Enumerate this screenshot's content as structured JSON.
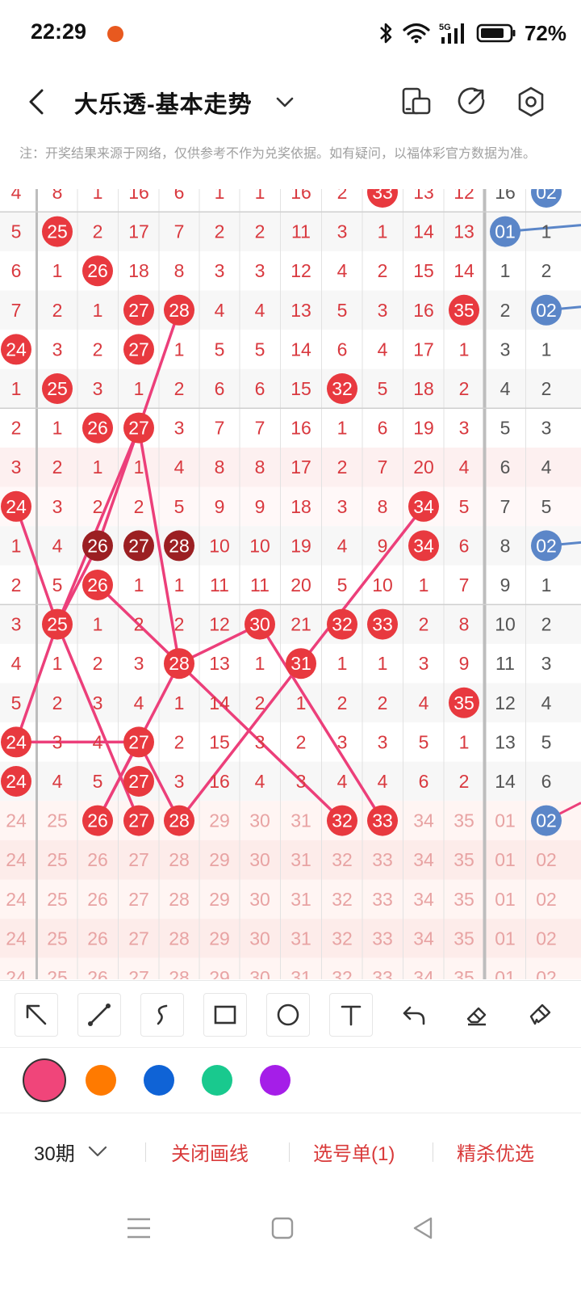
{
  "status": {
    "time": "22:29",
    "network": "5G",
    "battery": "72%"
  },
  "header": {
    "title": "大乐透-基本走势",
    "back_icon": "chevron-left-icon",
    "dropdown_icon": "chevron-down-icon",
    "actions": [
      "device-switch-icon",
      "share-icon",
      "settings-icon"
    ]
  },
  "notice": "注：开奖结果来源于网络，仅供参考不作为兑奖依据。如有疑问，以福体彩官方数据为准。",
  "colors": {
    "front_ball": "#e8393f",
    "front_ball_dark": "#9b1f22",
    "back_ball": "#5b86c8",
    "trend_line": "#ec3f7a",
    "number_text": "#d9393f",
    "back_text": "#555555",
    "stat_text": "#e8a3a3"
  },
  "grid": {
    "front_columns": [
      "24",
      "25",
      "26",
      "27",
      "28",
      "29",
      "30",
      "31",
      "32",
      "33",
      "34",
      "35"
    ],
    "back_columns": [
      "01",
      "02"
    ],
    "rows": [
      {
        "f": [
          "4",
          "8",
          "1",
          "16",
          "6",
          "1",
          "1",
          "16",
          "2",
          "33",
          "13",
          "12"
        ],
        "b": [
          "16",
          "02"
        ],
        "balls": [
          9
        ],
        "back_balls": [
          1
        ]
      },
      {
        "f": [
          "5",
          "25",
          "2",
          "17",
          "7",
          "2",
          "2",
          "11",
          "3",
          "1",
          "14",
          "13"
        ],
        "b": [
          "01",
          "1"
        ],
        "balls": [
          1
        ],
        "back_balls": [
          0
        ]
      },
      {
        "f": [
          "6",
          "1",
          "26",
          "18",
          "8",
          "3",
          "3",
          "12",
          "4",
          "2",
          "15",
          "14"
        ],
        "b": [
          "1",
          "2"
        ],
        "balls": [
          2
        ],
        "back_balls": []
      },
      {
        "f": [
          "7",
          "2",
          "1",
          "27",
          "28",
          "4",
          "4",
          "13",
          "5",
          "3",
          "16",
          "35"
        ],
        "b": [
          "2",
          "02"
        ],
        "balls": [
          3,
          4,
          11
        ],
        "back_balls": [
          1
        ]
      },
      {
        "f": [
          "24",
          "3",
          "2",
          "27",
          "1",
          "5",
          "5",
          "14",
          "6",
          "4",
          "17",
          "1"
        ],
        "b": [
          "3",
          "1"
        ],
        "balls": [
          0,
          3
        ],
        "back_balls": []
      },
      {
        "f": [
          "1",
          "25",
          "3",
          "1",
          "2",
          "6",
          "6",
          "15",
          "32",
          "5",
          "18",
          "2"
        ],
        "b": [
          "4",
          "2"
        ],
        "balls": [
          1,
          8
        ],
        "back_balls": []
      },
      {
        "f": [
          "2",
          "1",
          "26",
          "27",
          "3",
          "7",
          "7",
          "16",
          "1",
          "6",
          "19",
          "3"
        ],
        "b": [
          "5",
          "3"
        ],
        "balls": [
          2,
          3
        ],
        "back_balls": []
      },
      {
        "f": [
          "3",
          "2",
          "1",
          "1",
          "4",
          "8",
          "8",
          "17",
          "2",
          "7",
          "20",
          "4"
        ],
        "b": [
          "6",
          "4"
        ],
        "balls": [],
        "back_balls": []
      },
      {
        "f": [
          "24",
          "3",
          "2",
          "2",
          "5",
          "9",
          "9",
          "18",
          "3",
          "8",
          "34",
          "5"
        ],
        "b": [
          "7",
          "5"
        ],
        "balls": [
          0,
          10
        ],
        "back_balls": []
      },
      {
        "f": [
          "1",
          "4",
          "26",
          "27",
          "28",
          "10",
          "10",
          "19",
          "4",
          "9",
          "34",
          "6"
        ],
        "b": [
          "8",
          "02"
        ],
        "balls": [
          2,
          3,
          4,
          10
        ],
        "dark": [
          2,
          3,
          4
        ],
        "back_balls": [
          1
        ]
      },
      {
        "f": [
          "2",
          "5",
          "26",
          "1",
          "1",
          "11",
          "11",
          "20",
          "5",
          "10",
          "1",
          "7"
        ],
        "b": [
          "9",
          "1"
        ],
        "balls": [
          2
        ],
        "back_balls": []
      },
      {
        "f": [
          "3",
          "25",
          "1",
          "2",
          "2",
          "12",
          "30",
          "21",
          "32",
          "33",
          "2",
          "8"
        ],
        "b": [
          "10",
          "2"
        ],
        "balls": [
          1,
          6,
          8,
          9
        ],
        "back_balls": []
      },
      {
        "f": [
          "4",
          "1",
          "2",
          "3",
          "28",
          "13",
          "1",
          "31",
          "1",
          "1",
          "3",
          "9"
        ],
        "b": [
          "11",
          "3"
        ],
        "balls": [
          4,
          7
        ],
        "back_balls": []
      },
      {
        "f": [
          "5",
          "2",
          "3",
          "4",
          "1",
          "14",
          "2",
          "1",
          "2",
          "2",
          "4",
          "35"
        ],
        "b": [
          "12",
          "4"
        ],
        "balls": [
          11
        ],
        "back_balls": []
      },
      {
        "f": [
          "24",
          "3",
          "4",
          "27",
          "2",
          "15",
          "3",
          "2",
          "3",
          "3",
          "5",
          "1"
        ],
        "b": [
          "13",
          "5"
        ],
        "balls": [
          0,
          3
        ],
        "back_balls": []
      },
      {
        "f": [
          "24",
          "4",
          "5",
          "27",
          "3",
          "16",
          "4",
          "3",
          "4",
          "4",
          "6",
          "2"
        ],
        "b": [
          "14",
          "6"
        ],
        "balls": [
          0,
          3
        ],
        "back_balls": []
      },
      {
        "f": [
          "24",
          "25",
          "26",
          "27",
          "28",
          "29",
          "30",
          "31",
          "32",
          "33",
          "34",
          "35"
        ],
        "b": [
          "01",
          "02"
        ],
        "balls": [
          2,
          3,
          4,
          8,
          9
        ],
        "back_balls": [
          1
        ]
      },
      {
        "f": [
          "24",
          "25",
          "26",
          "27",
          "28",
          "29",
          "30",
          "31",
          "32",
          "33",
          "34",
          "35"
        ],
        "b": [
          "01",
          "02"
        ],
        "balls": [],
        "back_balls": [],
        "stat": true
      },
      {
        "f": [
          "24",
          "25",
          "26",
          "27",
          "28",
          "29",
          "30",
          "31",
          "32",
          "33",
          "34",
          "35"
        ],
        "b": [
          "01",
          "02"
        ],
        "balls": [],
        "back_balls": [],
        "stat": true
      },
      {
        "f": [
          "24",
          "25",
          "26",
          "27",
          "28",
          "29",
          "30",
          "31",
          "32",
          "33",
          "34",
          "35"
        ],
        "b": [
          "01",
          "02"
        ],
        "balls": [],
        "back_balls": [],
        "stat": true
      },
      {
        "f": [
          "24",
          "25",
          "26",
          "27",
          "28",
          "29",
          "30",
          "31",
          "32",
          "33",
          "34",
          "35"
        ],
        "b": [
          "01",
          "02"
        ],
        "balls": [],
        "back_balls": [],
        "stat": true
      }
    ]
  },
  "toolbar": {
    "tools": [
      "arrow-tool-icon",
      "line-tool-icon",
      "freehand-tool-icon",
      "rectangle-tool-icon",
      "circle-tool-icon",
      "text-tool-icon",
      "undo-icon",
      "eraser-icon",
      "clear-brush-icon"
    ]
  },
  "palette": [
    "#f0457a",
    "#ff7a00",
    "#0f63d6",
    "#19c98e",
    "#a51ee8"
  ],
  "bottom": {
    "period": "30期",
    "close_lines": "关闭画线",
    "selection": "选号单(1)",
    "premium": "精杀优选"
  }
}
